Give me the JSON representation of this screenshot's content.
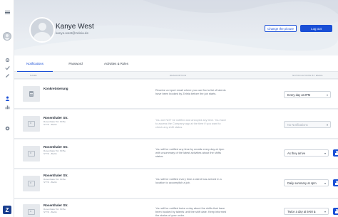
{
  "sidebar": {
    "logo_letter": "Z",
    "icons": [
      "menu-icon",
      "avatar",
      "settings-icon",
      "check-icon",
      "pencil-icon",
      "person-icon",
      "chart-icon",
      "help-icon"
    ]
  },
  "profile": {
    "name": "Kanye West",
    "email": "kanye.west@zeleia.de",
    "change_picture_label": "Change the picture",
    "logout_label": "Log out"
  },
  "tabs": [
    {
      "label": "Notifications",
      "active": true
    },
    {
      "label": "Password",
      "active": false
    },
    {
      "label": "Activities & Roles",
      "active": false
    }
  ],
  "table": {
    "headers": [
      "NAME",
      "DESCRIPTION",
      "NOTIFICATIONS BY EMAIL"
    ],
    "rows": [
      {
        "title": "Konkretisierung",
        "subtitle": "",
        "description": "Receive a report email where you can find a list of talents have been booked by Zeleia before the job starts.",
        "setting": "Every day at 2PM",
        "disabled": false,
        "locked": false
      },
      {
        "title": "Rosenthaler Str.",
        "subtitle": "Rosenthaler Str. 60 Be\nSTYS - Berlin",
        "description": "You are NOT be notified and annoyed any time. You have to access the Company app at the time if you want to check any shift status.",
        "setting": "No Notifications",
        "disabled": true,
        "locked": false
      },
      {
        "title": "Rosenthaler Str.",
        "subtitle": "Rosenthaler Str. 60 Be\nSTYS - Berlin",
        "description": "You will be notified any time by emails every day at 4pm with a summary of the latest activities about the shifts status.",
        "setting": "As they arrive",
        "disabled": false,
        "locked": true
      },
      {
        "title": "Rosenthaler Str.",
        "subtitle": "Rosenthaler Str. 60 Be\nSTYS - Berlin",
        "description": "You will be notified every time a talent has arrived in a location to accomplish a job.",
        "setting": "Daily summary at 4pm",
        "disabled": false,
        "locked": true
      },
      {
        "title": "Rosenthaler Str.",
        "subtitle": "Rosenthaler Str. 60 Be\nSTYS - Berlin",
        "description": "You will be notified twice a day about the shifts that have been booked by talents until the shift date. Keep informed the status of your order.",
        "setting": "Twice a day at 9AM &",
        "disabled": false,
        "locked": true
      }
    ]
  },
  "colors": {
    "accent": "#1a4fd6",
    "header_bg": "#dde2ea",
    "page_bg": "#eef0f3"
  }
}
